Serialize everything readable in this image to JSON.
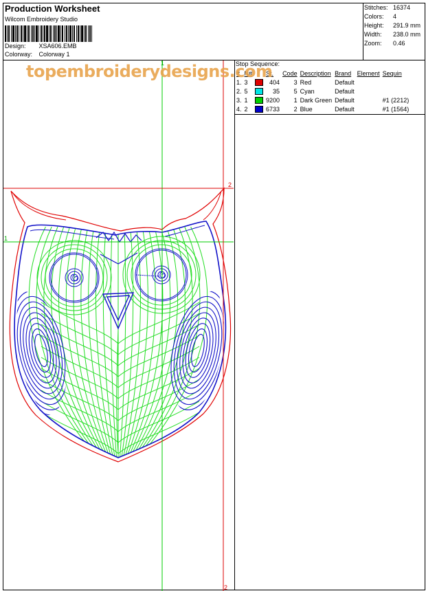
{
  "header": {
    "title": "Production Worksheet",
    "software": "Wilcom Embroidery Studio",
    "design_label": "Design:",
    "design_value": "XSA606.EMB",
    "colorway_label": "Colorway:",
    "colorway_value": "Colorway 1"
  },
  "stats": [
    {
      "key": "Stitches:",
      "value": "16374"
    },
    {
      "key": "Colors:",
      "value": "4"
    },
    {
      "key": "Height:",
      "value": "291.9 mm"
    },
    {
      "key": "Width:",
      "value": "238.0 mm"
    },
    {
      "key": "Zoom:",
      "value": "0.46"
    }
  ],
  "stop_sequence": {
    "title": "Stop Sequence:",
    "columns": [
      "#",
      "N#",
      "St.",
      "Code",
      "Description",
      "Brand",
      "Element",
      "Sequin"
    ],
    "rows": [
      {
        "num": "1.",
        "n": "3",
        "color": "#e00000",
        "st": "404",
        "code": "3",
        "desc": "Red",
        "brand": "Default",
        "element": "",
        "sequin": ""
      },
      {
        "num": "2.",
        "n": "5",
        "color": "#00e5e5",
        "st": "35",
        "code": "5",
        "desc": "Cyan",
        "brand": "Default",
        "element": "",
        "sequin": ""
      },
      {
        "num": "3.",
        "n": "1",
        "color": "#00d000",
        "st": "9200",
        "code": "1",
        "desc": "Dark Green",
        "brand": "Default",
        "element": "",
        "sequin": "#1 (2212)"
      },
      {
        "num": "4.",
        "n": "2",
        "color": "#0000cc",
        "st": "6733",
        "code": "2",
        "desc": "Blue",
        "brand": "Default",
        "element": "",
        "sequin": "#1 (1564)"
      }
    ]
  },
  "watermark": "topembroiderydesigns.com",
  "guides": {
    "v1": "1",
    "h1": "1",
    "v2": "2",
    "h2": "2"
  },
  "colors": {
    "red": "#e00000",
    "green": "#22dd22",
    "blue": "#1010c8",
    "guide_green": "#00cc00",
    "guide_red": "#dd0000"
  }
}
